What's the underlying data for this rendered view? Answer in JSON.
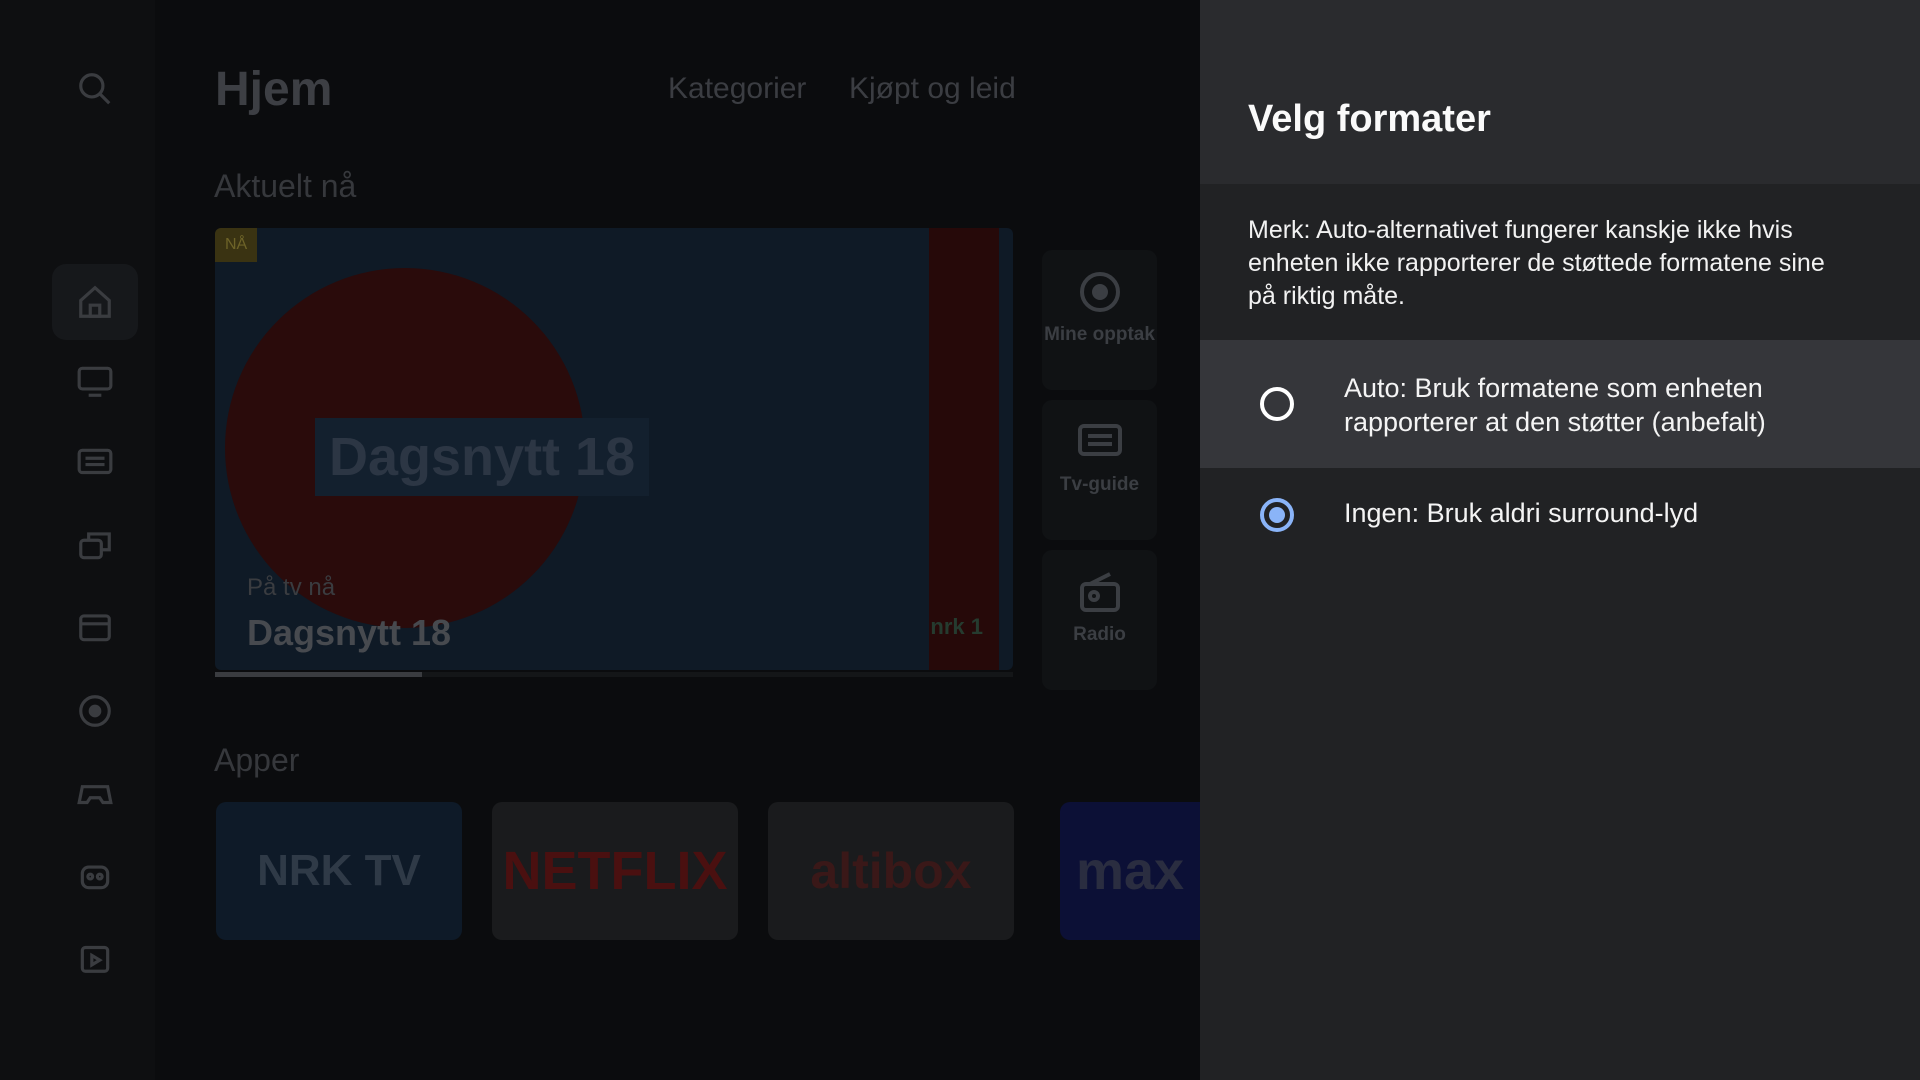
{
  "home": {
    "title": "Hjem",
    "nav": [
      "Kategorier",
      "Kjøpt og leid"
    ],
    "section_current": "Aktuelt nå",
    "hero": {
      "badge": "NÅ",
      "overlay_title": "Dagsnytt 18",
      "subtitle": "På tv nå",
      "program": "Dagsnytt 18",
      "channel_logo": "nrk 1",
      "progress": 0.26
    },
    "quick_tiles": [
      {
        "label": "Mine opptak",
        "icon": "record-icon"
      },
      {
        "label": "Tv-guide",
        "icon": "guide-icon"
      },
      {
        "label": "Radio",
        "icon": "radio-icon"
      }
    ],
    "section_apps": "Apper",
    "apps": [
      "NRK TV",
      "NETFLIX",
      "altibox",
      "max"
    ],
    "sidebar_icons": [
      "search-icon",
      "home-icon",
      "tv-icon",
      "guide-icon",
      "library-icon",
      "movies-icon",
      "record-icon",
      "games-icon",
      "kids-icon",
      "apps-icon"
    ]
  },
  "panel": {
    "title": "Velg formater",
    "note": "Merk: Auto-alternativet fungerer kanskje ikke hvis enheten ikke rapporterer de støttede formatene sine på riktig måte.",
    "options": [
      {
        "label": "Auto: Bruk formatene som enheten rapporterer at den støtter (anbefalt)",
        "selected": false,
        "focused": true
      },
      {
        "label": "Ingen: Bruk aldri surround-lyd",
        "selected": true,
        "focused": false
      }
    ],
    "accent_color": "#8ab4f8"
  }
}
